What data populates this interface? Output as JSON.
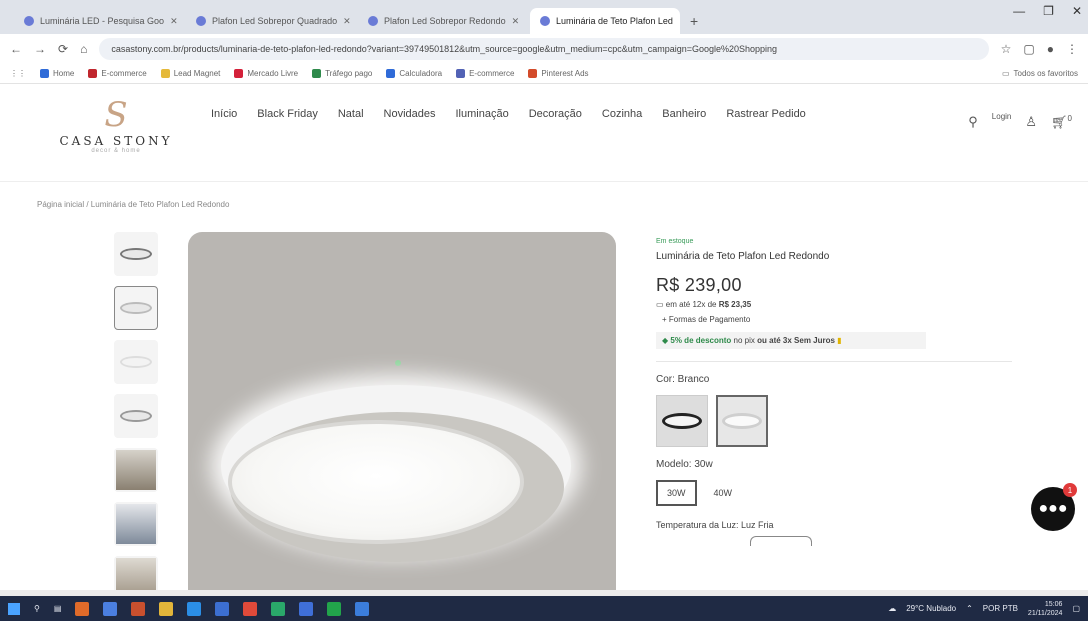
{
  "browser": {
    "tabs": [
      {
        "title": "Luminária LED - Pesquisa Goo"
      },
      {
        "title": "Plafon Led Sobrepor Quadrado"
      },
      {
        "title": "Plafon Led Sobrepor Redondo"
      },
      {
        "title": "Luminária de Teto Plafon Led"
      }
    ],
    "url": "casastony.com.br/products/luminaria-de-teto-plafon-led-redondo?variant=39749501812&utm_source=google&utm_medium=cpc&utm_campaign=Google%20Shopping",
    "bookmarks": [
      "Home",
      "E-commerce",
      "Lead Magnet",
      "Mercado Livre",
      "Tráfego pago",
      "Calculadora",
      "E-commerce",
      "Pinterest Ads"
    ],
    "bookmarks_right": "Todos os favoritos"
  },
  "site": {
    "logo": {
      "mark": "S",
      "text": "CASA STONY",
      "sub": "decor & home"
    },
    "nav": [
      "Início",
      "Black Friday",
      "Natal",
      "Novidades",
      "Iluminação",
      "Decoração",
      "Cozinha",
      "Banheiro",
      "Rastrear Pedido"
    ],
    "login_label": "Login",
    "cart_count": "0"
  },
  "breadcrumb": "Página inicial / Luminária de Teto Plafon Led Redondo",
  "product": {
    "stock_label": "Em estoque",
    "title": "Luminária de Teto Plafon Led Redondo",
    "price": "R$ 239,00",
    "installments_prefix": "em até 12x de",
    "installments_value": "R$ 23,35",
    "payment_link": "+ Formas de Pagamento",
    "discount_highlight": "5% de desconto",
    "discount_mid": "no pix",
    "discount_suffix": "ou até 3x Sem Juros",
    "color_label": "Cor: Branco",
    "model_label": "Modelo: 30w",
    "models": [
      "30W",
      "40W"
    ],
    "temperature_label": "Temperatura da Luz: Luz Fria"
  },
  "chat": {
    "badge": "1"
  },
  "taskbar": {
    "weather": "29°C Nublado",
    "lang": "POR PTB",
    "time": "15:06",
    "date": "21/11/2024"
  }
}
